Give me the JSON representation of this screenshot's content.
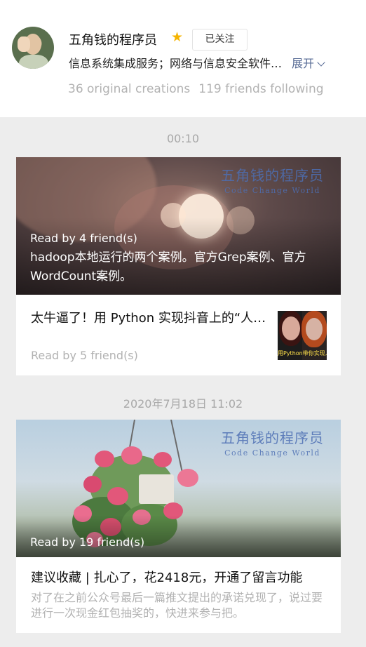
{
  "profile": {
    "name": "五角钱的程序员",
    "follow_label": "已关注",
    "description": "信息系统集成服务；网络与信息安全软件开发",
    "expand_label": "展开",
    "original_creations": "36 original creations",
    "friends_following": "119 friends following"
  },
  "groups": [
    {
      "time": "00:10",
      "watermark": {
        "title": "五角钱的程序员",
        "subtitle": "Code Change World"
      },
      "lead": {
        "read_by": "Read by 4 friend(s)",
        "title": "hadoop本地运行的两个案例。官方Grep案例、官方WordCount案例。"
      },
      "second": {
        "title": "太牛逼了！用 Python 实现抖音上的“人像动漫化”特效",
        "read_by": "Read by 5 friend(s)",
        "thumb_caption": "用Python带你实现人像"
      }
    },
    {
      "time": "2020年7月18日 11:02",
      "watermark": {
        "title": "五角钱的程序员",
        "subtitle": "Code Change World"
      },
      "lead": {
        "read_by": "Read by 19 friend(s)"
      },
      "second": {
        "title": "建议收藏 | 扎心了，花2418元，开通了留言功能",
        "digest": "对了在之前公众号最后一篇推文提出的承诺兑现了，说过要进行一次现金红包抽奖的，快进来参与把。"
      }
    }
  ]
}
